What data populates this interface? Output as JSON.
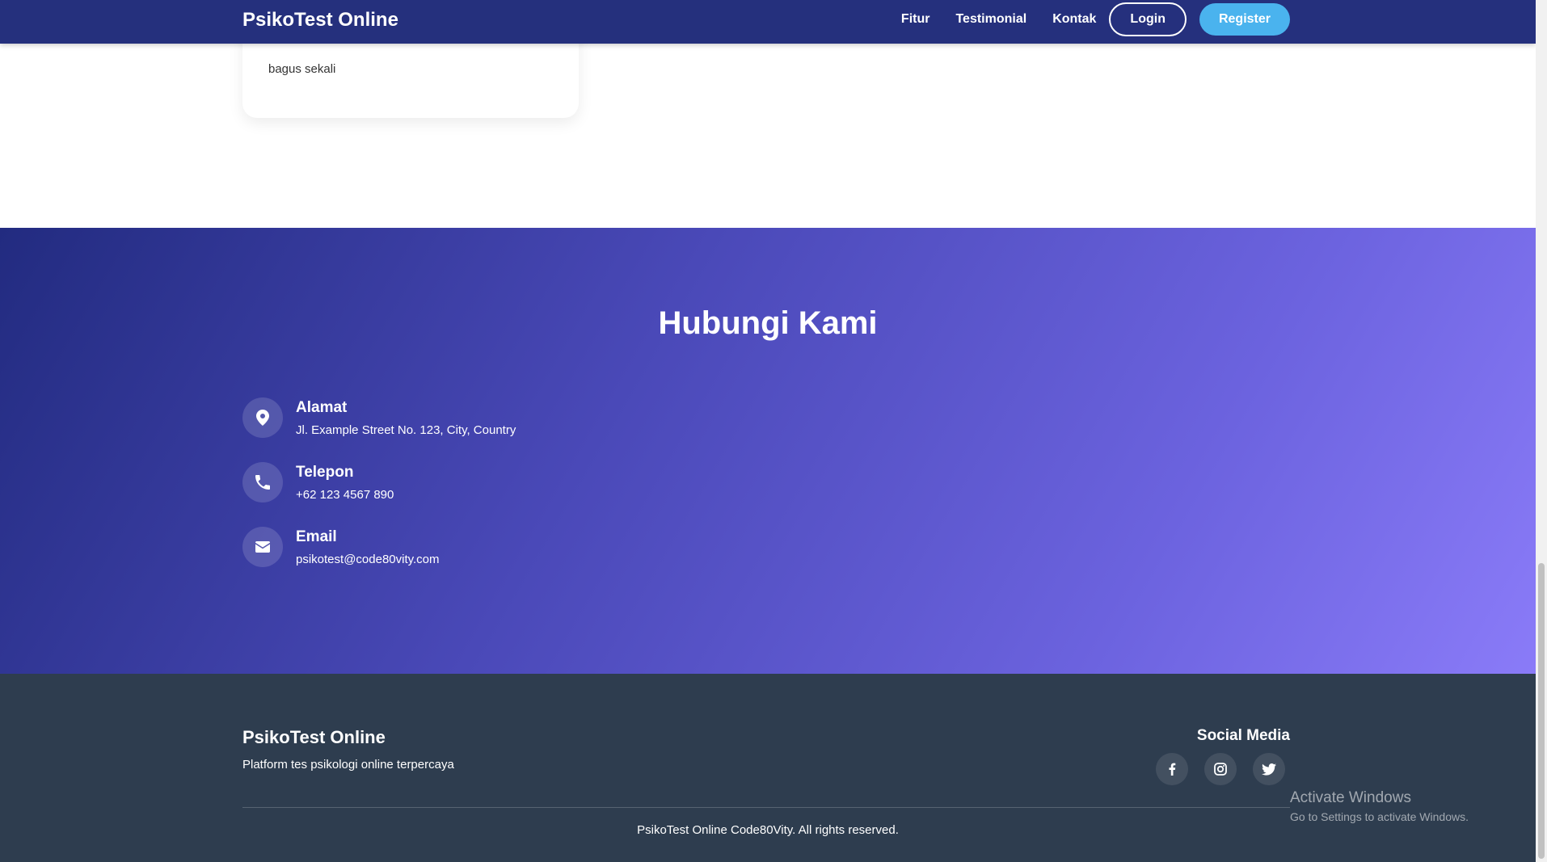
{
  "navbar": {
    "brand": "PsikoTest Online",
    "links": [
      "Fitur",
      "Testimonial",
      "Kontak"
    ],
    "login_label": "Login",
    "register_label": "Register",
    "background_color": "#25307d",
    "register_color": "#4ab3ee"
  },
  "testimonial": {
    "text": "bagus sekali"
  },
  "contact": {
    "title": "Hubungi Kami",
    "items": [
      {
        "icon": "map-pin-icon",
        "label": "Alamat",
        "value": "Jl. Example Street No. 123, City, Country"
      },
      {
        "icon": "phone-icon",
        "label": "Telepon",
        "value": "+62 123 4567 890"
      },
      {
        "icon": "envelope-icon",
        "label": "Email",
        "value": "psikotest@code80vity.com"
      }
    ]
  },
  "footer": {
    "brand": "PsikoTest Online",
    "tagline": "Platform tes psikologi online terpercaya",
    "social_title": "Social Media",
    "social_icons": [
      "facebook-icon",
      "instagram-icon",
      "twitter-icon"
    ],
    "copyright": "PsikoTest Online Code80Vity. All rights reserved.",
    "background_color": "#2e3d4f"
  },
  "watermark": {
    "title": "Activate Windows",
    "subtitle": "Go to Settings to activate Windows."
  }
}
